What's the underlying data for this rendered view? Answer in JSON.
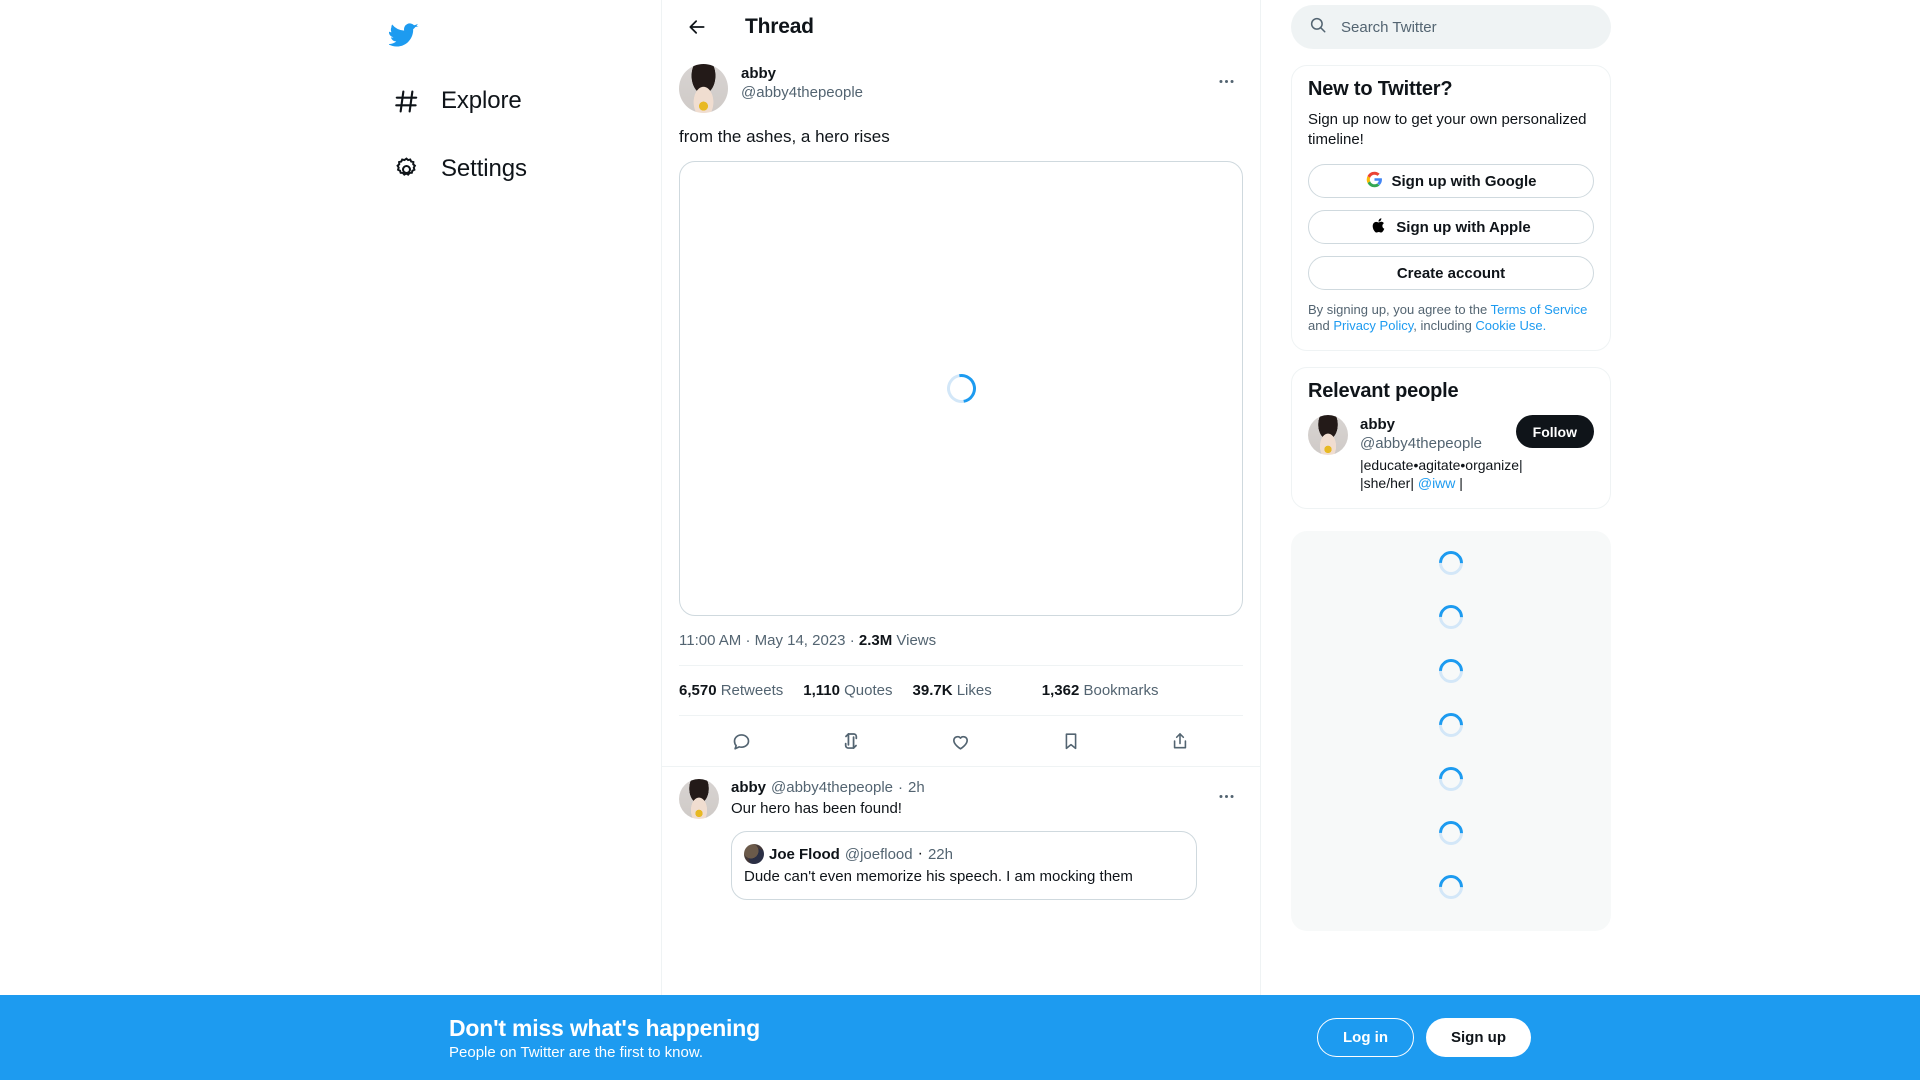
{
  "sidebar": {
    "logo": "twitter-bird-logo",
    "items": [
      {
        "label": "Explore",
        "icon": "hashtag-icon"
      },
      {
        "label": "Settings",
        "icon": "gear-icon"
      }
    ]
  },
  "header": {
    "title": "Thread",
    "back_icon": "back-arrow-icon"
  },
  "tweet": {
    "display_name": "abby",
    "handle": "@abby4thepeople",
    "text": "from the ashes, a hero rises",
    "media_state": "loading",
    "timestamp": "11:00 AM",
    "date": "May 14, 2023",
    "views_count": "2.3M",
    "views_label": "Views",
    "separator": "·",
    "stats": [
      {
        "value": "6,570",
        "label": "Retweets"
      },
      {
        "value": "1,110",
        "label": "Quotes"
      },
      {
        "value": "39.7K",
        "label": "Likes"
      },
      {
        "value": "1,362",
        "label": "Bookmarks"
      }
    ],
    "actions": [
      {
        "name": "reply-icon"
      },
      {
        "name": "retweet-icon"
      },
      {
        "name": "like-icon"
      },
      {
        "name": "bookmark-icon"
      },
      {
        "name": "share-icon"
      }
    ]
  },
  "reply": {
    "display_name": "abby",
    "handle": "@abby4thepeople",
    "dot": "·",
    "time": "2h",
    "text": "Our hero has been found!",
    "quote": {
      "display_name": "Joe Flood",
      "handle": "@joeflood",
      "dot": "·",
      "time": "22h",
      "text": "Dude can't even memorize his speech. I am mocking them"
    }
  },
  "search": {
    "placeholder": "Search Twitter",
    "value": "",
    "icon": "search-icon"
  },
  "signup_card": {
    "title": "New to Twitter?",
    "subtitle": "Sign up now to get your own personalized timeline!",
    "google_button": "Sign up with Google",
    "apple_button": "Sign up with Apple",
    "create_button": "Create account",
    "legal_prefix": "By signing up, you agree to the ",
    "terms_link": "Terms of Service",
    "legal_and": " and ",
    "privacy_link": "Privacy Policy",
    "legal_including": ", including ",
    "cookie_link": "Cookie Use."
  },
  "relevant_people": {
    "title": "Relevant people",
    "person": {
      "display_name": "abby",
      "handle": "@abby4thepeople",
      "bio": "|educate•agitate•organize| |she/her| ",
      "bio_link": "@iww",
      "bio_suffix": " |",
      "follow_label": "Follow"
    }
  },
  "loading_panel": {
    "state": "loading",
    "spinner_count": 7
  },
  "banner": {
    "title": "Don't miss what's happening",
    "subtitle": "People on Twitter are the first to know.",
    "login_label": "Log in",
    "signup_label": "Sign up"
  },
  "colors": {
    "brand_blue": "#1d9bf0",
    "text_primary": "#0f1419",
    "text_secondary": "#536471",
    "border": "#eff3f4",
    "border_strong": "#cfd9de",
    "surface_muted": "#f7f9f9",
    "follow_black": "#0f1419"
  }
}
